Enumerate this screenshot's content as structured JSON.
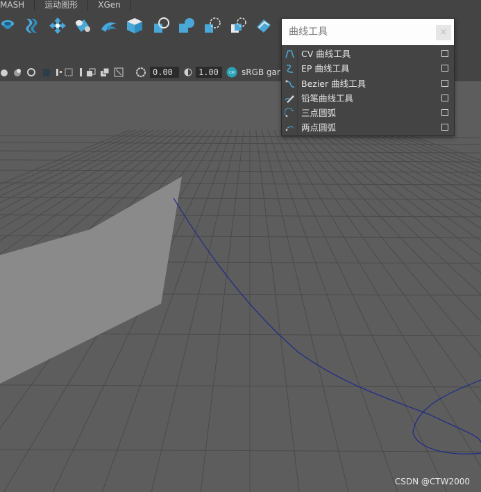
{
  "tabs": [
    "MASH",
    "运动图形",
    "XGen"
  ],
  "shelf": {
    "icons": [
      "toilet-icon",
      "wave-icon",
      "move-icon",
      "cylinder-icon",
      "ribbon-icon",
      "cube-icon",
      "sphere-icon",
      "cone-icon",
      "circle-icon",
      "square-icon",
      "plane-icon"
    ],
    "accent": "#4aa8d8"
  },
  "viewbar": {
    "value_a": "0.00",
    "value_b": "1.00",
    "colorspace": "sRGB gar"
  },
  "popup": {
    "title": "曲线工具",
    "close": "×",
    "items": [
      {
        "label": "CV 曲线工具",
        "icon": "cv-curve-icon"
      },
      {
        "label": "EP 曲线工具",
        "icon": "ep-curve-icon"
      },
      {
        "label": "Bezier 曲线工具",
        "icon": "bezier-curve-icon"
      },
      {
        "label": "铅笔曲线工具",
        "icon": "pencil-curve-icon"
      },
      {
        "label": "三点圆弧",
        "icon": "three-point-arc-icon"
      },
      {
        "label": "两点圆弧",
        "icon": "two-point-arc-icon"
      }
    ]
  },
  "viewport": {
    "grid_color": "#4a4a4a",
    "curve_color": "#1d2a8a",
    "plane_color": "#8a8a8a"
  },
  "watermark": "CSDN @CTW2000"
}
